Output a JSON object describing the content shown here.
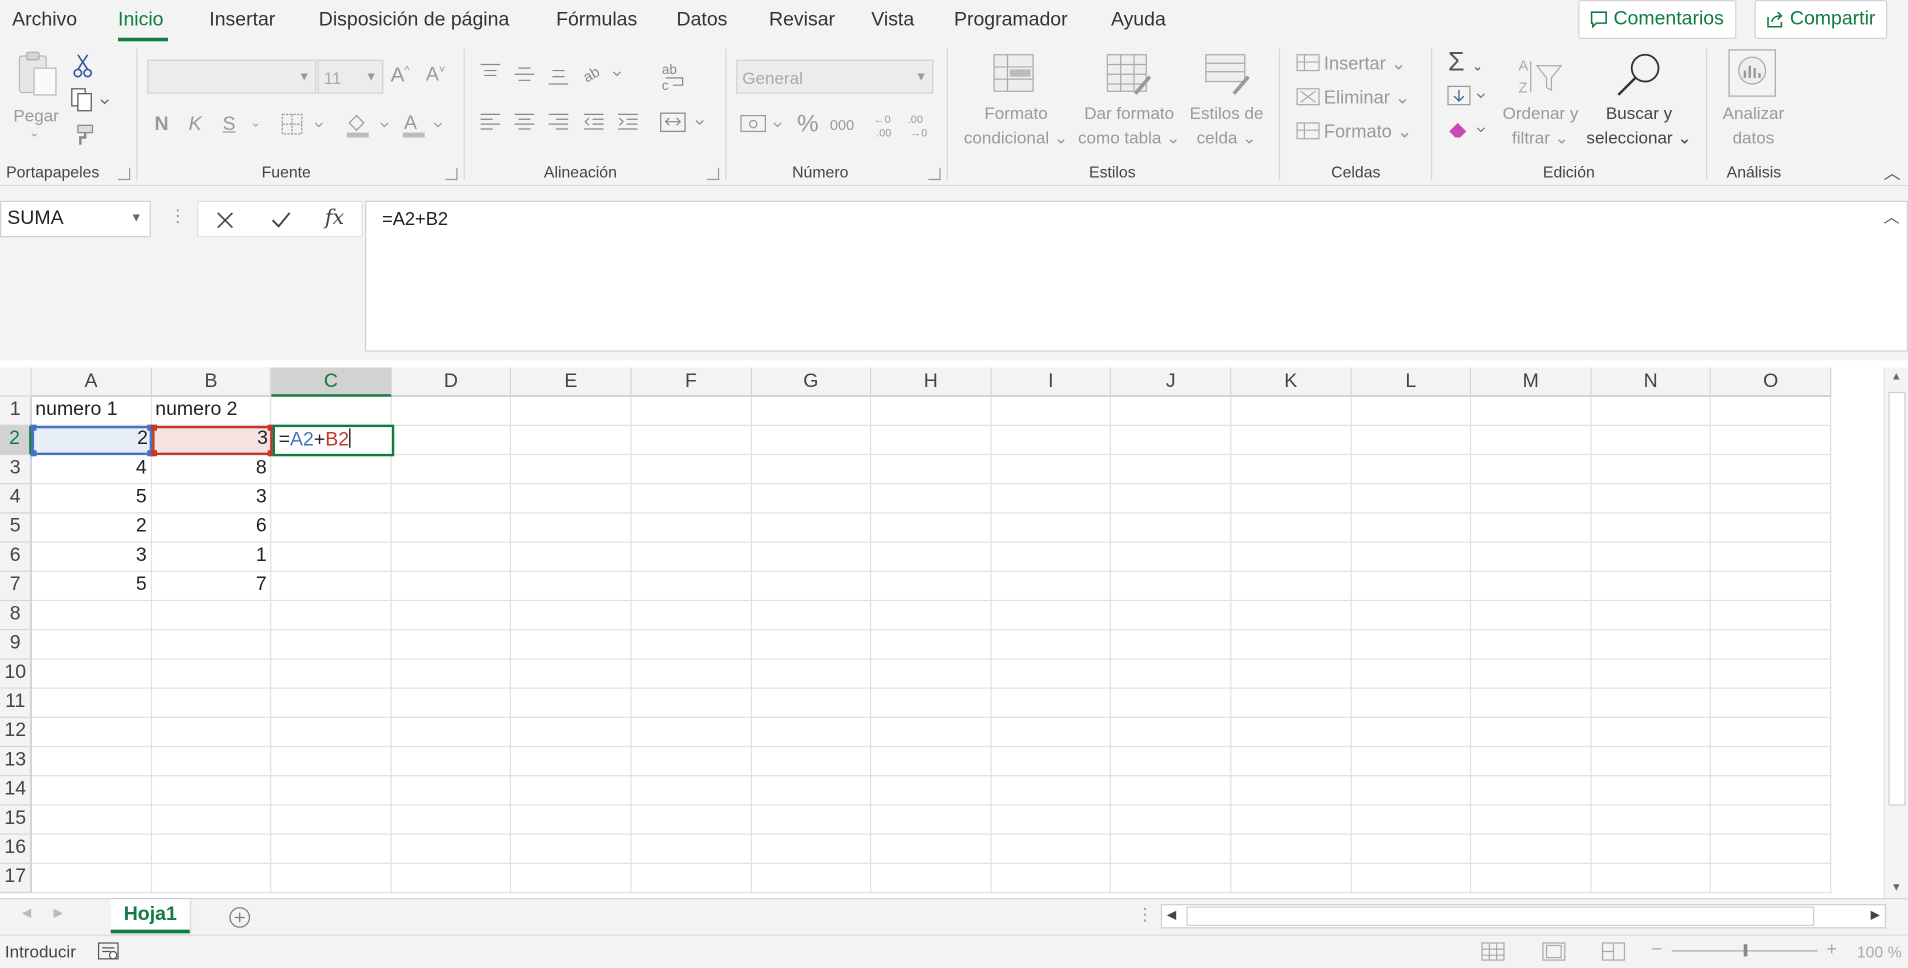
{
  "menu": {
    "tabs": [
      "Archivo",
      "Inicio",
      "Insertar",
      "Disposición de página",
      "Fórmulas",
      "Datos",
      "Revisar",
      "Vista",
      "Programador",
      "Ayuda"
    ],
    "active_tab": "Inicio",
    "comments_label": "Comentarios",
    "share_label": "Compartir"
  },
  "ribbon": {
    "clipboard": {
      "paste_label": "Pegar",
      "group_label": "Portapapeles"
    },
    "font": {
      "font_name": "",
      "font_size": "11",
      "bold": "N",
      "italic": "K",
      "underline": "S",
      "group_label": "Fuente"
    },
    "alignment": {
      "group_label": "Alineación"
    },
    "number": {
      "format": "General",
      "percent": "%",
      "thousands": "000",
      "group_label": "Número"
    },
    "styles": {
      "conditional_line1": "Formato",
      "conditional_line2": "condicional",
      "table_line1": "Dar formato",
      "table_line2": "como tabla",
      "cellstyle_line1": "Estilos de",
      "cellstyle_line2": "celda",
      "group_label": "Estilos"
    },
    "cells": {
      "insert": "Insertar",
      "delete": "Eliminar",
      "format": "Formato",
      "group_label": "Celdas"
    },
    "editing": {
      "sort_line1": "Ordenar y",
      "sort_line2": "filtrar",
      "find_line1": "Buscar y",
      "find_line2": "seleccionar",
      "group_label": "Edición"
    },
    "analysis": {
      "line1": "Analizar",
      "line2": "datos",
      "group_label": "Análisis"
    }
  },
  "formula_bar": {
    "name_box": "SUMA",
    "formula": "=A2+B2"
  },
  "sheet": {
    "columns": [
      "A",
      "B",
      "C",
      "D",
      "E",
      "F",
      "G",
      "H",
      "I",
      "J",
      "K",
      "L",
      "M",
      "N",
      "O"
    ],
    "rows": [
      "1",
      "2",
      "3",
      "4",
      "5",
      "6",
      "7",
      "8",
      "9",
      "10",
      "11",
      "12",
      "13",
      "14",
      "15",
      "16",
      "17"
    ],
    "header_a": "numero 1",
    "header_b": "numero 2",
    "data": [
      [
        "2",
        "3"
      ],
      [
        "4",
        "8"
      ],
      [
        "5",
        "3"
      ],
      [
        "2",
        "6"
      ],
      [
        "3",
        "1"
      ],
      [
        "5",
        "7"
      ]
    ],
    "active_cell": {
      "prefix": "=",
      "ref1": "A2",
      "op": "+",
      "ref2": "B2"
    },
    "colors": {
      "ref1": "#4472c4",
      "ref2": "#c0392b",
      "accent": "#107c41"
    }
  },
  "sheet_tabs": {
    "active": "Hoja1"
  },
  "status": {
    "mode": "Introducir",
    "zoom": "100 %"
  }
}
